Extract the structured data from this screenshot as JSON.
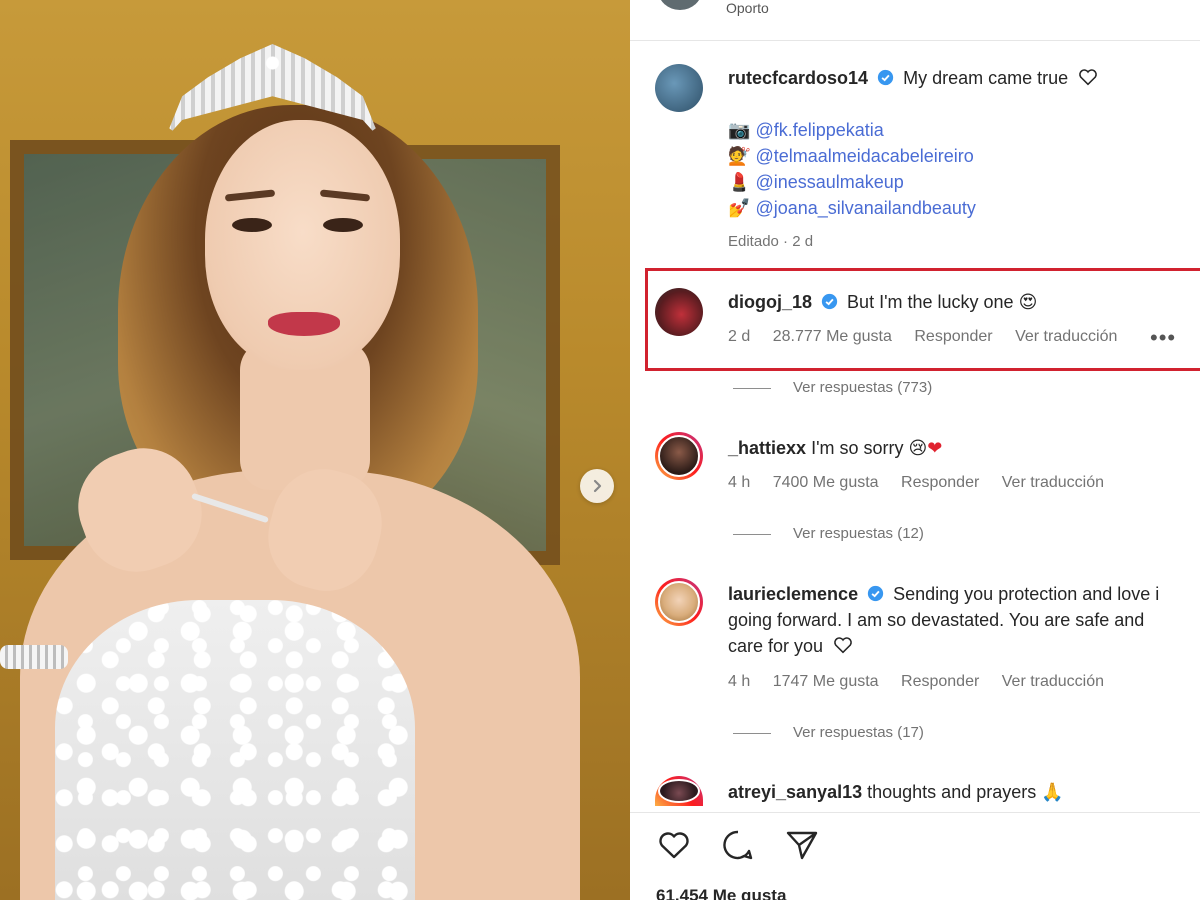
{
  "location": "Oporto",
  "post": {
    "author": "rutecfcardoso14",
    "caption": "My dream came true",
    "mentions": [
      {
        "icon": "camera-emoji",
        "handle": "@fk.felippekatia"
      },
      {
        "icon": "hairdresser-emoji",
        "handle": "@telmaalmeidacabeleireiro"
      },
      {
        "icon": "lipstick-emoji",
        "handle": "@inessaulmakeup"
      },
      {
        "icon": "nail-polish-emoji",
        "handle": "@joana_silvanailandbeauty"
      }
    ],
    "edited": "Editado · 2 d",
    "total_likes": "61.454 Me gusta"
  },
  "comments": [
    {
      "user": "diogoj_18",
      "verified": true,
      "text": "But I'm the lucky one",
      "emoji": "heart-eyes-emoji",
      "time": "2 d",
      "likes": "28.777 Me gusta",
      "reply": "Responder",
      "translate": "Ver traducción",
      "replies": "Ver respuestas (773)",
      "highlighted": true
    },
    {
      "user": "_hattiexx",
      "verified": false,
      "text": "I'm so sorry",
      "emoji": "sad-face-and-red-heart-emoji",
      "time": "4 h",
      "likes": "7400 Me gusta",
      "reply": "Responder",
      "translate": "Ver traducción",
      "replies": "Ver respuestas (12)"
    },
    {
      "user": "laurieclemence",
      "verified": true,
      "text_lines": [
        "Sending you protection and love i",
        "going forward. I am so devastated. You are safe and",
        "care for you"
      ],
      "time": "4 h",
      "likes": "1747 Me gusta",
      "reply": "Responder",
      "translate": "Ver traducción",
      "replies": "Ver respuestas (17)"
    },
    {
      "user": "atreyi_sanyal13",
      "verified": false,
      "text": "thoughts and prayers",
      "emoji": "praying-hands-emoji"
    }
  ],
  "more_label": "•••",
  "colors": {
    "highlight_border": "#d1222f",
    "mention": "#4a6cd4",
    "verified": "#3897f0",
    "muted": "#737373"
  }
}
